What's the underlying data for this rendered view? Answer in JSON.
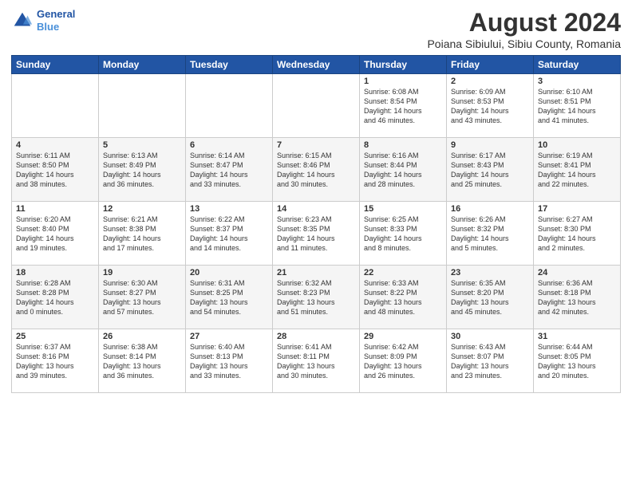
{
  "header": {
    "logo_line1": "General",
    "logo_line2": "Blue",
    "title": "August 2024",
    "subtitle": "Poiana Sibiului, Sibiu County, Romania"
  },
  "columns": [
    "Sunday",
    "Monday",
    "Tuesday",
    "Wednesday",
    "Thursday",
    "Friday",
    "Saturday"
  ],
  "weeks": [
    [
      {
        "day": "",
        "info": ""
      },
      {
        "day": "",
        "info": ""
      },
      {
        "day": "",
        "info": ""
      },
      {
        "day": "",
        "info": ""
      },
      {
        "day": "1",
        "info": "Sunrise: 6:08 AM\nSunset: 8:54 PM\nDaylight: 14 hours\nand 46 minutes."
      },
      {
        "day": "2",
        "info": "Sunrise: 6:09 AM\nSunset: 8:53 PM\nDaylight: 14 hours\nand 43 minutes."
      },
      {
        "day": "3",
        "info": "Sunrise: 6:10 AM\nSunset: 8:51 PM\nDaylight: 14 hours\nand 41 minutes."
      }
    ],
    [
      {
        "day": "4",
        "info": "Sunrise: 6:11 AM\nSunset: 8:50 PM\nDaylight: 14 hours\nand 38 minutes."
      },
      {
        "day": "5",
        "info": "Sunrise: 6:13 AM\nSunset: 8:49 PM\nDaylight: 14 hours\nand 36 minutes."
      },
      {
        "day": "6",
        "info": "Sunrise: 6:14 AM\nSunset: 8:47 PM\nDaylight: 14 hours\nand 33 minutes."
      },
      {
        "day": "7",
        "info": "Sunrise: 6:15 AM\nSunset: 8:46 PM\nDaylight: 14 hours\nand 30 minutes."
      },
      {
        "day": "8",
        "info": "Sunrise: 6:16 AM\nSunset: 8:44 PM\nDaylight: 14 hours\nand 28 minutes."
      },
      {
        "day": "9",
        "info": "Sunrise: 6:17 AM\nSunset: 8:43 PM\nDaylight: 14 hours\nand 25 minutes."
      },
      {
        "day": "10",
        "info": "Sunrise: 6:19 AM\nSunset: 8:41 PM\nDaylight: 14 hours\nand 22 minutes."
      }
    ],
    [
      {
        "day": "11",
        "info": "Sunrise: 6:20 AM\nSunset: 8:40 PM\nDaylight: 14 hours\nand 19 minutes."
      },
      {
        "day": "12",
        "info": "Sunrise: 6:21 AM\nSunset: 8:38 PM\nDaylight: 14 hours\nand 17 minutes."
      },
      {
        "day": "13",
        "info": "Sunrise: 6:22 AM\nSunset: 8:37 PM\nDaylight: 14 hours\nand 14 minutes."
      },
      {
        "day": "14",
        "info": "Sunrise: 6:23 AM\nSunset: 8:35 PM\nDaylight: 14 hours\nand 11 minutes."
      },
      {
        "day": "15",
        "info": "Sunrise: 6:25 AM\nSunset: 8:33 PM\nDaylight: 14 hours\nand 8 minutes."
      },
      {
        "day": "16",
        "info": "Sunrise: 6:26 AM\nSunset: 8:32 PM\nDaylight: 14 hours\nand 5 minutes."
      },
      {
        "day": "17",
        "info": "Sunrise: 6:27 AM\nSunset: 8:30 PM\nDaylight: 14 hours\nand 2 minutes."
      }
    ],
    [
      {
        "day": "18",
        "info": "Sunrise: 6:28 AM\nSunset: 8:28 PM\nDaylight: 14 hours\nand 0 minutes."
      },
      {
        "day": "19",
        "info": "Sunrise: 6:30 AM\nSunset: 8:27 PM\nDaylight: 13 hours\nand 57 minutes."
      },
      {
        "day": "20",
        "info": "Sunrise: 6:31 AM\nSunset: 8:25 PM\nDaylight: 13 hours\nand 54 minutes."
      },
      {
        "day": "21",
        "info": "Sunrise: 6:32 AM\nSunset: 8:23 PM\nDaylight: 13 hours\nand 51 minutes."
      },
      {
        "day": "22",
        "info": "Sunrise: 6:33 AM\nSunset: 8:22 PM\nDaylight: 13 hours\nand 48 minutes."
      },
      {
        "day": "23",
        "info": "Sunrise: 6:35 AM\nSunset: 8:20 PM\nDaylight: 13 hours\nand 45 minutes."
      },
      {
        "day": "24",
        "info": "Sunrise: 6:36 AM\nSunset: 8:18 PM\nDaylight: 13 hours\nand 42 minutes."
      }
    ],
    [
      {
        "day": "25",
        "info": "Sunrise: 6:37 AM\nSunset: 8:16 PM\nDaylight: 13 hours\nand 39 minutes."
      },
      {
        "day": "26",
        "info": "Sunrise: 6:38 AM\nSunset: 8:14 PM\nDaylight: 13 hours\nand 36 minutes."
      },
      {
        "day": "27",
        "info": "Sunrise: 6:40 AM\nSunset: 8:13 PM\nDaylight: 13 hours\nand 33 minutes."
      },
      {
        "day": "28",
        "info": "Sunrise: 6:41 AM\nSunset: 8:11 PM\nDaylight: 13 hours\nand 30 minutes."
      },
      {
        "day": "29",
        "info": "Sunrise: 6:42 AM\nSunset: 8:09 PM\nDaylight: 13 hours\nand 26 minutes."
      },
      {
        "day": "30",
        "info": "Sunrise: 6:43 AM\nSunset: 8:07 PM\nDaylight: 13 hours\nand 23 minutes."
      },
      {
        "day": "31",
        "info": "Sunrise: 6:44 AM\nSunset: 8:05 PM\nDaylight: 13 hours\nand 20 minutes."
      }
    ]
  ]
}
